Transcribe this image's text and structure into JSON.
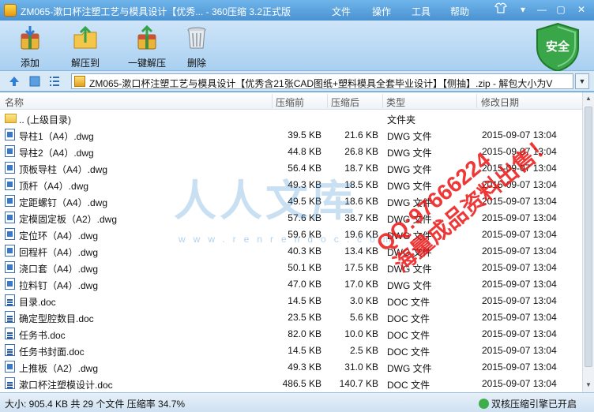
{
  "titlebar": {
    "title": "ZM065-漱口杯注塑工艺与模具设计【优秀... - 360压缩 3.2正式版",
    "menus": [
      "文件",
      "操作",
      "工具",
      "帮助"
    ]
  },
  "toolbar": {
    "buttons": [
      "添加",
      "解压到",
      "一键解压",
      "删除"
    ],
    "security_badge": "安全"
  },
  "addressbar": {
    "path": "ZM065-漱口杯注塑工艺与模具设计【优秀含21张CAD图纸+塑料模具全套毕业设计】【侧抽】.zip - 解包大小为V"
  },
  "columns": {
    "name": "名称",
    "size": "压缩前",
    "compressed": "压缩后",
    "type": "类型",
    "date": "修改日期"
  },
  "files": [
    {
      "name": ".. (上级目录)",
      "size": "",
      "compressed": "",
      "type": "文件夹",
      "date": "",
      "icon": "folder-icon"
    },
    {
      "name": "导柱1（A4）.dwg",
      "size": "39.5 KB",
      "compressed": "21.6 KB",
      "type": "DWG 文件",
      "date": "2015-09-07 13:04",
      "icon": "dwg-file-icon"
    },
    {
      "name": "导柱2（A4）.dwg",
      "size": "44.8 KB",
      "compressed": "26.8 KB",
      "type": "DWG 文件",
      "date": "2015-09-07 13:04",
      "icon": "dwg-file-icon"
    },
    {
      "name": "顶板导柱（A4）.dwg",
      "size": "56.4 KB",
      "compressed": "18.7 KB",
      "type": "DWG 文件",
      "date": "2015-09-07 13:04",
      "icon": "dwg-file-icon"
    },
    {
      "name": "顶杆（A4）.dwg",
      "size": "49.3 KB",
      "compressed": "18.5 KB",
      "type": "DWG 文件",
      "date": "2015-09-07 13:04",
      "icon": "dwg-file-icon"
    },
    {
      "name": "定距螺钉（A4）.dwg",
      "size": "49.5 KB",
      "compressed": "18.6 KB",
      "type": "DWG 文件",
      "date": "2015-09-07 13:04",
      "icon": "dwg-file-icon"
    },
    {
      "name": "定模固定板（A2）.dwg",
      "size": "57.6 KB",
      "compressed": "38.7 KB",
      "type": "DWG 文件",
      "date": "2015-09-07 13:04",
      "icon": "dwg-file-icon"
    },
    {
      "name": "定位环（A4）.dwg",
      "size": "59.6 KB",
      "compressed": "19.6 KB",
      "type": "DWG 文件",
      "date": "2015-09-07 13:04",
      "icon": "dwg-file-icon"
    },
    {
      "name": "回程杆（A4）.dwg",
      "size": "40.3 KB",
      "compressed": "13.4 KB",
      "type": "DWG 文件",
      "date": "2015-09-07 13:04",
      "icon": "dwg-file-icon"
    },
    {
      "name": "浇口套（A4）.dwg",
      "size": "50.1 KB",
      "compressed": "17.5 KB",
      "type": "DWG 文件",
      "date": "2015-09-07 13:04",
      "icon": "dwg-file-icon"
    },
    {
      "name": "拉料钉（A4）.dwg",
      "size": "47.0 KB",
      "compressed": "17.0 KB",
      "type": "DWG 文件",
      "date": "2015-09-07 13:04",
      "icon": "dwg-file-icon"
    },
    {
      "name": "目录.doc",
      "size": "14.5 KB",
      "compressed": "3.0 KB",
      "type": "DOC 文件",
      "date": "2015-09-07 13:04",
      "icon": "doc-file-icon"
    },
    {
      "name": "确定型腔数目.doc",
      "size": "23.5 KB",
      "compressed": "5.6 KB",
      "type": "DOC 文件",
      "date": "2015-09-07 13:04",
      "icon": "doc-file-icon"
    },
    {
      "name": "任务书.doc",
      "size": "82.0 KB",
      "compressed": "10.0 KB",
      "type": "DOC 文件",
      "date": "2015-09-07 13:04",
      "icon": "doc-file-icon"
    },
    {
      "name": "任务书封面.doc",
      "size": "14.5 KB",
      "compressed": "2.5 KB",
      "type": "DOC 文件",
      "date": "2015-09-07 13:04",
      "icon": "doc-file-icon"
    },
    {
      "name": "上推板（A2）.dwg",
      "size": "49.3 KB",
      "compressed": "31.0 KB",
      "type": "DWG 文件",
      "date": "2015-09-07 13:04",
      "icon": "dwg-file-icon"
    },
    {
      "name": "漱口杯注塑模设计.doc",
      "size": "486.5 KB",
      "compressed": "140.7 KB",
      "type": "DOC 文件",
      "date": "2015-09-07 13:04",
      "icon": "doc-file-icon"
    }
  ],
  "status": {
    "summary": "大小: 905.4 KB 共 29 个文件 压缩率 34.7%",
    "engine": "双核压缩引擎已开启"
  },
  "watermarks": {
    "logo": "人人文库",
    "url": "www.renrendoc.com",
    "promo_line1": "QQ:97666224",
    "promo_line2": "海量成品资料出售！"
  }
}
